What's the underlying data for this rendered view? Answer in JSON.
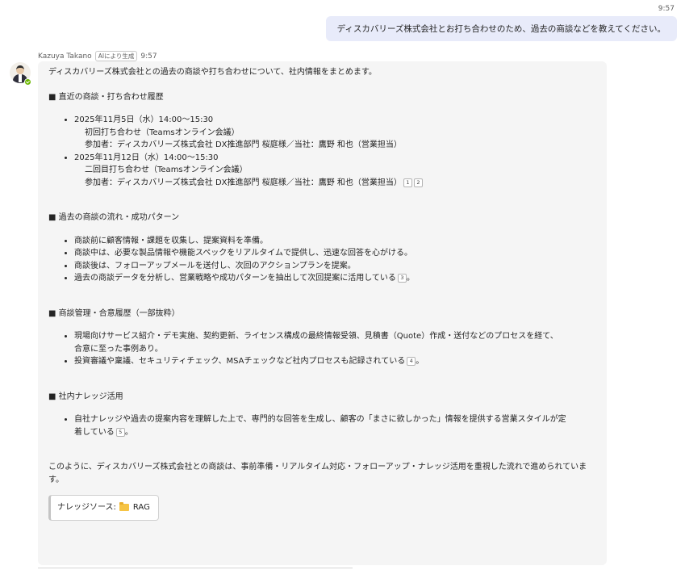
{
  "outgoing": {
    "time": "9:57",
    "text": "ディスカバリーズ株式会社とお打ち合わせのため、過去の商談などを教えてください。"
  },
  "incoming": {
    "author": "Kazuya Takano",
    "ai_badge": "AIにより生成",
    "time": "9:57",
    "intro": "ディスカバリーズ株式会社との過去の商談や打ち合わせについて、社内情報をまとめます。",
    "sections": [
      {
        "heading": "■ 直近の商談・打ち合わせ履歴",
        "items": [
          {
            "line1": "2025年11月5日（水）14:00〜15:30",
            "line2": "初回打ち合わせ（Teamsオンライン会議）",
            "line3": "参加者：ディスカバリーズ株式会社 DX推進部門 桜庭様／当社：鷹野 和也（営業担当）"
          },
          {
            "line1": "2025年11月12日（水）14:00〜15:30",
            "line2": "二回目打ち合わせ（Teamsオンライン会議）",
            "line3": "参加者：ディスカバリーズ株式会社 DX推進部門 桜庭様／当社：鷹野 和也（営業担当）",
            "cites": [
              "1",
              "2"
            ]
          }
        ]
      },
      {
        "heading": "■ 過去の商談の流れ・成功パターン",
        "items": [
          "商談前に顧客情報・課題を収集し、提案資料を準備。",
          "商談中は、必要な製品情報や機能スペックをリアルタイムで提供し、迅速な回答を心がける。",
          "商談後は、フォローアップメールを送付し、次回のアクションプランを提案。",
          "過去の商談データを分析し、営業戦略や成功パターンを抽出して次回提案に活用している"
        ],
        "cite": "3",
        "period": "。"
      },
      {
        "heading": "■ 商談管理・合意履歴（一部抜粋）",
        "items": [
          "現場向けサービス紹介・デモ実施、契約更新、ライセンス構成の最終情報受領、見積書（Quote）作成・送付などのプロセスを経て、",
          "合意に至った事例あり。",
          "投資審議や稟議、セキュリティチェック、MSAチェックなど社内プロセスも記録されている"
        ],
        "cite": "4",
        "period": "。"
      },
      {
        "heading": "■ 社内ナレッジ活用",
        "items": [
          "自社ナレッジや過去の提案内容を理解した上で、専門的な回答を生成し、顧客の「まさに欲しかった」情報を提供する営業スタイルが定",
          "着している"
        ],
        "cite": "5",
        "period": "。"
      }
    ],
    "conclusion": "このように、ディスカバリーズ株式会社との商談は、事前準備・リアルタイム対応・フォローアップ・ナレッジ活用を重視した流れで進められています。",
    "source": {
      "label": "ナレッジソース:",
      "folder_icon": "folder-icon",
      "name": "RAG"
    }
  }
}
